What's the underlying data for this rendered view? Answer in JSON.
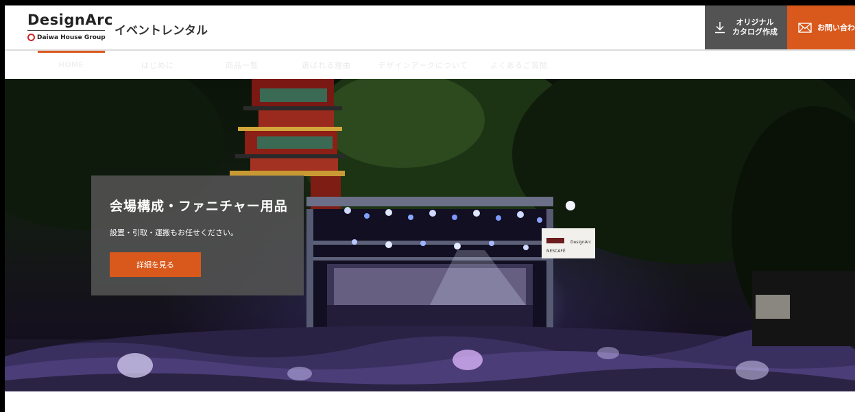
{
  "header": {
    "logo_main": "DesignArc",
    "logo_sub": "Daiwa House Group",
    "site_name": "イベントレンタル",
    "catalog_line1": "オリジナル",
    "catalog_line2": "カタログ作成",
    "contact_label": "お問い合わせ"
  },
  "nav": {
    "items": [
      {
        "label": "HOME"
      },
      {
        "label": "はじめに"
      },
      {
        "label": "商品一覧"
      },
      {
        "label": "選ばれる理由"
      },
      {
        "label": "デザインアークについて"
      },
      {
        "label": "よくあるご質問"
      }
    ],
    "active_index": 0
  },
  "hero": {
    "title": "会場構成・ファニチャー用品",
    "subtitle": "設置・引取・運搬もお任せください。",
    "button_label": "詳細を見る",
    "banner_brand_1": "NESCAFÉ",
    "banner_brand_2": "DesignArc"
  },
  "colors": {
    "accent": "#d9581c",
    "catalog_bg": "#535353",
    "panel_bg": "#555555"
  }
}
